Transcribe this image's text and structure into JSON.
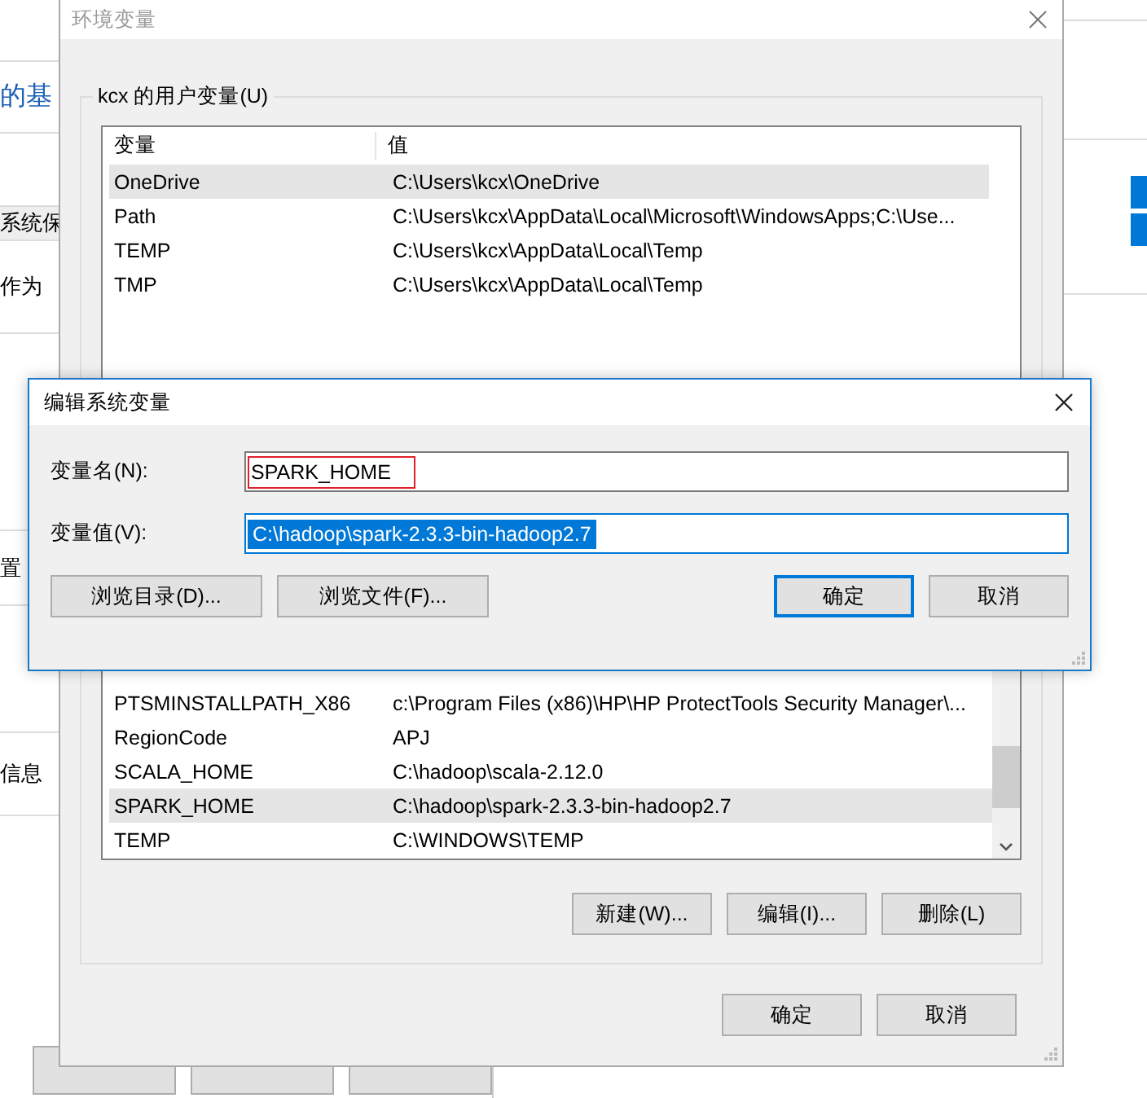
{
  "background_window": {
    "texts": [
      {
        "text": "的基",
        "kind": "link"
      },
      {
        "text": "系统保",
        "kind": "band"
      },
      {
        "text": "作为",
        "kind": "text"
      },
      {
        "text": "置",
        "kind": "text"
      },
      {
        "text": "信息",
        "kind": "text"
      }
    ]
  },
  "env_window": {
    "title": "环境变量",
    "active": false,
    "user_group": {
      "title": "kcx 的用户变量(U)",
      "columns": [
        "变量",
        "值"
      ],
      "rows": [
        {
          "name": "OneDrive",
          "value": "C:\\Users\\kcx\\OneDrive",
          "selected": true
        },
        {
          "name": "Path",
          "value": "C:\\Users\\kcx\\AppData\\Local\\Microsoft\\WindowsApps;C:\\Use...",
          "selected": false
        },
        {
          "name": "TEMP",
          "value": "C:\\Users\\kcx\\AppData\\Local\\Temp",
          "selected": false
        },
        {
          "name": "TMP",
          "value": "C:\\Users\\kcx\\AppData\\Local\\Temp",
          "selected": false
        }
      ]
    },
    "system_rows": [
      {
        "name": "PTSMINSTALLPATH_X86",
        "value": "c:\\Program Files (x86)\\HP\\HP ProtectTools Security Manager\\...",
        "selected": false
      },
      {
        "name": "RegionCode",
        "value": "APJ",
        "selected": false
      },
      {
        "name": "SCALA_HOME",
        "value": "C:\\hadoop\\scala-2.12.0",
        "selected": false
      },
      {
        "name": "SPARK_HOME",
        "value": "C:\\hadoop\\spark-2.3.3-bin-hadoop2.7",
        "selected": true
      },
      {
        "name": "TEMP",
        "value": "C:\\WINDOWS\\TEMP",
        "selected": false
      }
    ],
    "system_buttons": [
      "新建(W)...",
      "编辑(I)...",
      "删除(L)"
    ],
    "buttons": [
      "确定",
      "取消"
    ]
  },
  "edit_dialog": {
    "title": "编辑系统变量",
    "fields": [
      {
        "label": "变量名(N):",
        "value": "SPARK_HOME",
        "focused": false,
        "text_selected": false,
        "annotated": true
      },
      {
        "label": "变量值(V):",
        "value": "C:\\hadoop\\spark-2.3.3-bin-hadoop2.7",
        "focused": true,
        "text_selected": true,
        "annotated": false
      }
    ],
    "browse_buttons": [
      "浏览目录(D)...",
      "浏览文件(F)..."
    ],
    "buttons": [
      {
        "label": "确定",
        "default": true
      },
      {
        "label": "取消",
        "default": false
      }
    ]
  }
}
